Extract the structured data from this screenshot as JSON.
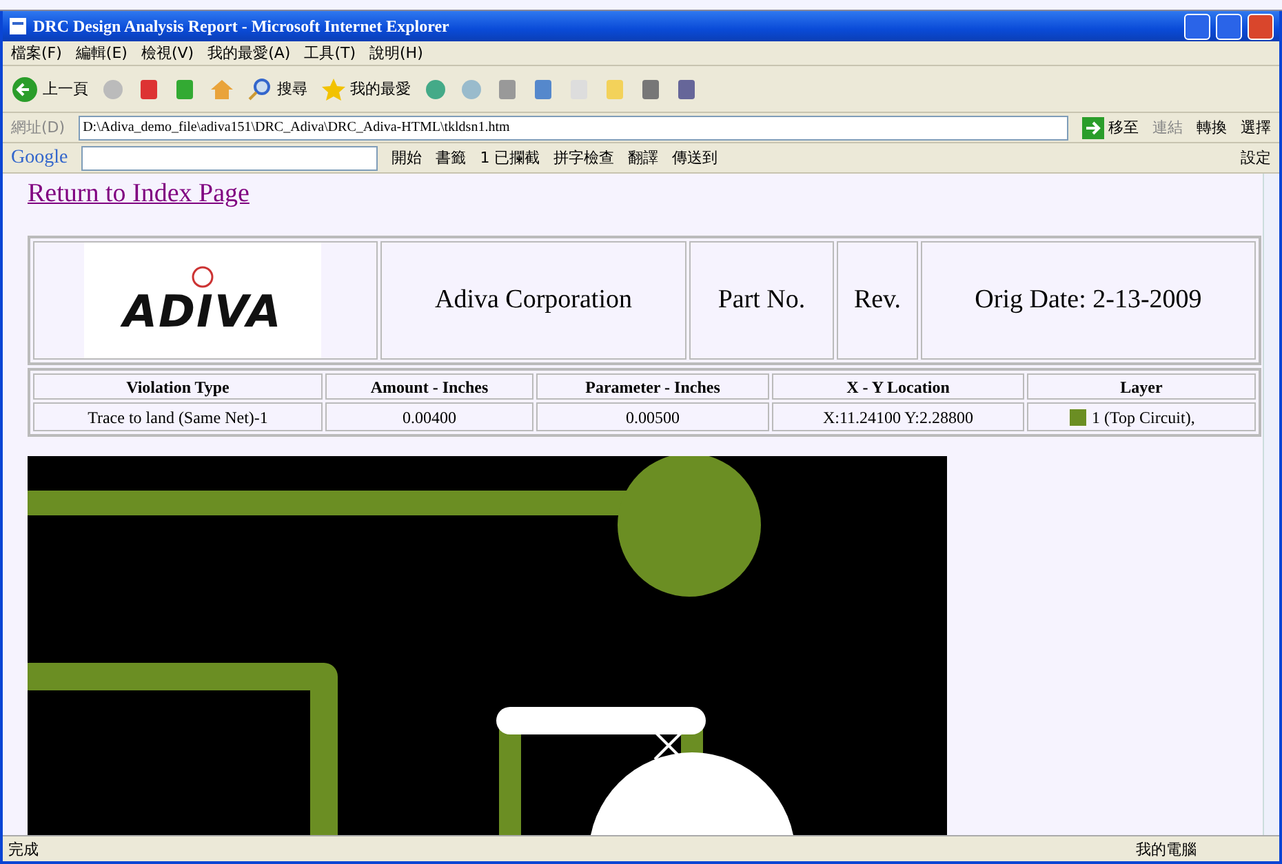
{
  "window": {
    "title": "DRC Design Analysis Report - Microsoft Internet Explorer"
  },
  "menu": [
    "檔案(F)",
    "編輯(E)",
    "檢視(V)",
    "我的最愛(A)",
    "工具(T)",
    "說明(H)"
  ],
  "toolbar": {
    "back": "上一頁",
    "search": "搜尋",
    "favorites": "我的最愛"
  },
  "address": {
    "label": "網址(D)",
    "value": "D:\\Adiva_demo_file\\adiva151\\DRC_Adiva\\DRC_Adiva-HTML\\tkldsn1.htm",
    "go": "移至",
    "links": "連結",
    "convert": "轉換",
    "select": "選擇"
  },
  "google_bar": {
    "logo": "Google",
    "start": "開始",
    "bookmarks": "書籤",
    "blocked": "1 已攔截",
    "spell": "拼字檢查",
    "translate": "翻譯",
    "send": "傳送到",
    "settings": "設定"
  },
  "page": {
    "link": "Return to Index Page",
    "header": {
      "logo": "ADIVA",
      "company": "Adiva Corporation",
      "part": "Part No.",
      "rev": "Rev.",
      "date": "Orig Date: 2-13-2009"
    },
    "table": {
      "columns": [
        "Violation Type",
        "Amount - Inches",
        "Parameter - Inches",
        "X - Y Location",
        "Layer"
      ],
      "rows": [
        {
          "cells": [
            "Trace to land (Same Net)-1",
            "0.00400",
            "0.00500",
            "X:11.24100 Y:2.28800",
            "1 (Top Circuit),"
          ],
          "color": "#6b8e23"
        }
      ]
    }
  },
  "status_bar": {
    "text": "完成",
    "zone": "我的電腦"
  }
}
